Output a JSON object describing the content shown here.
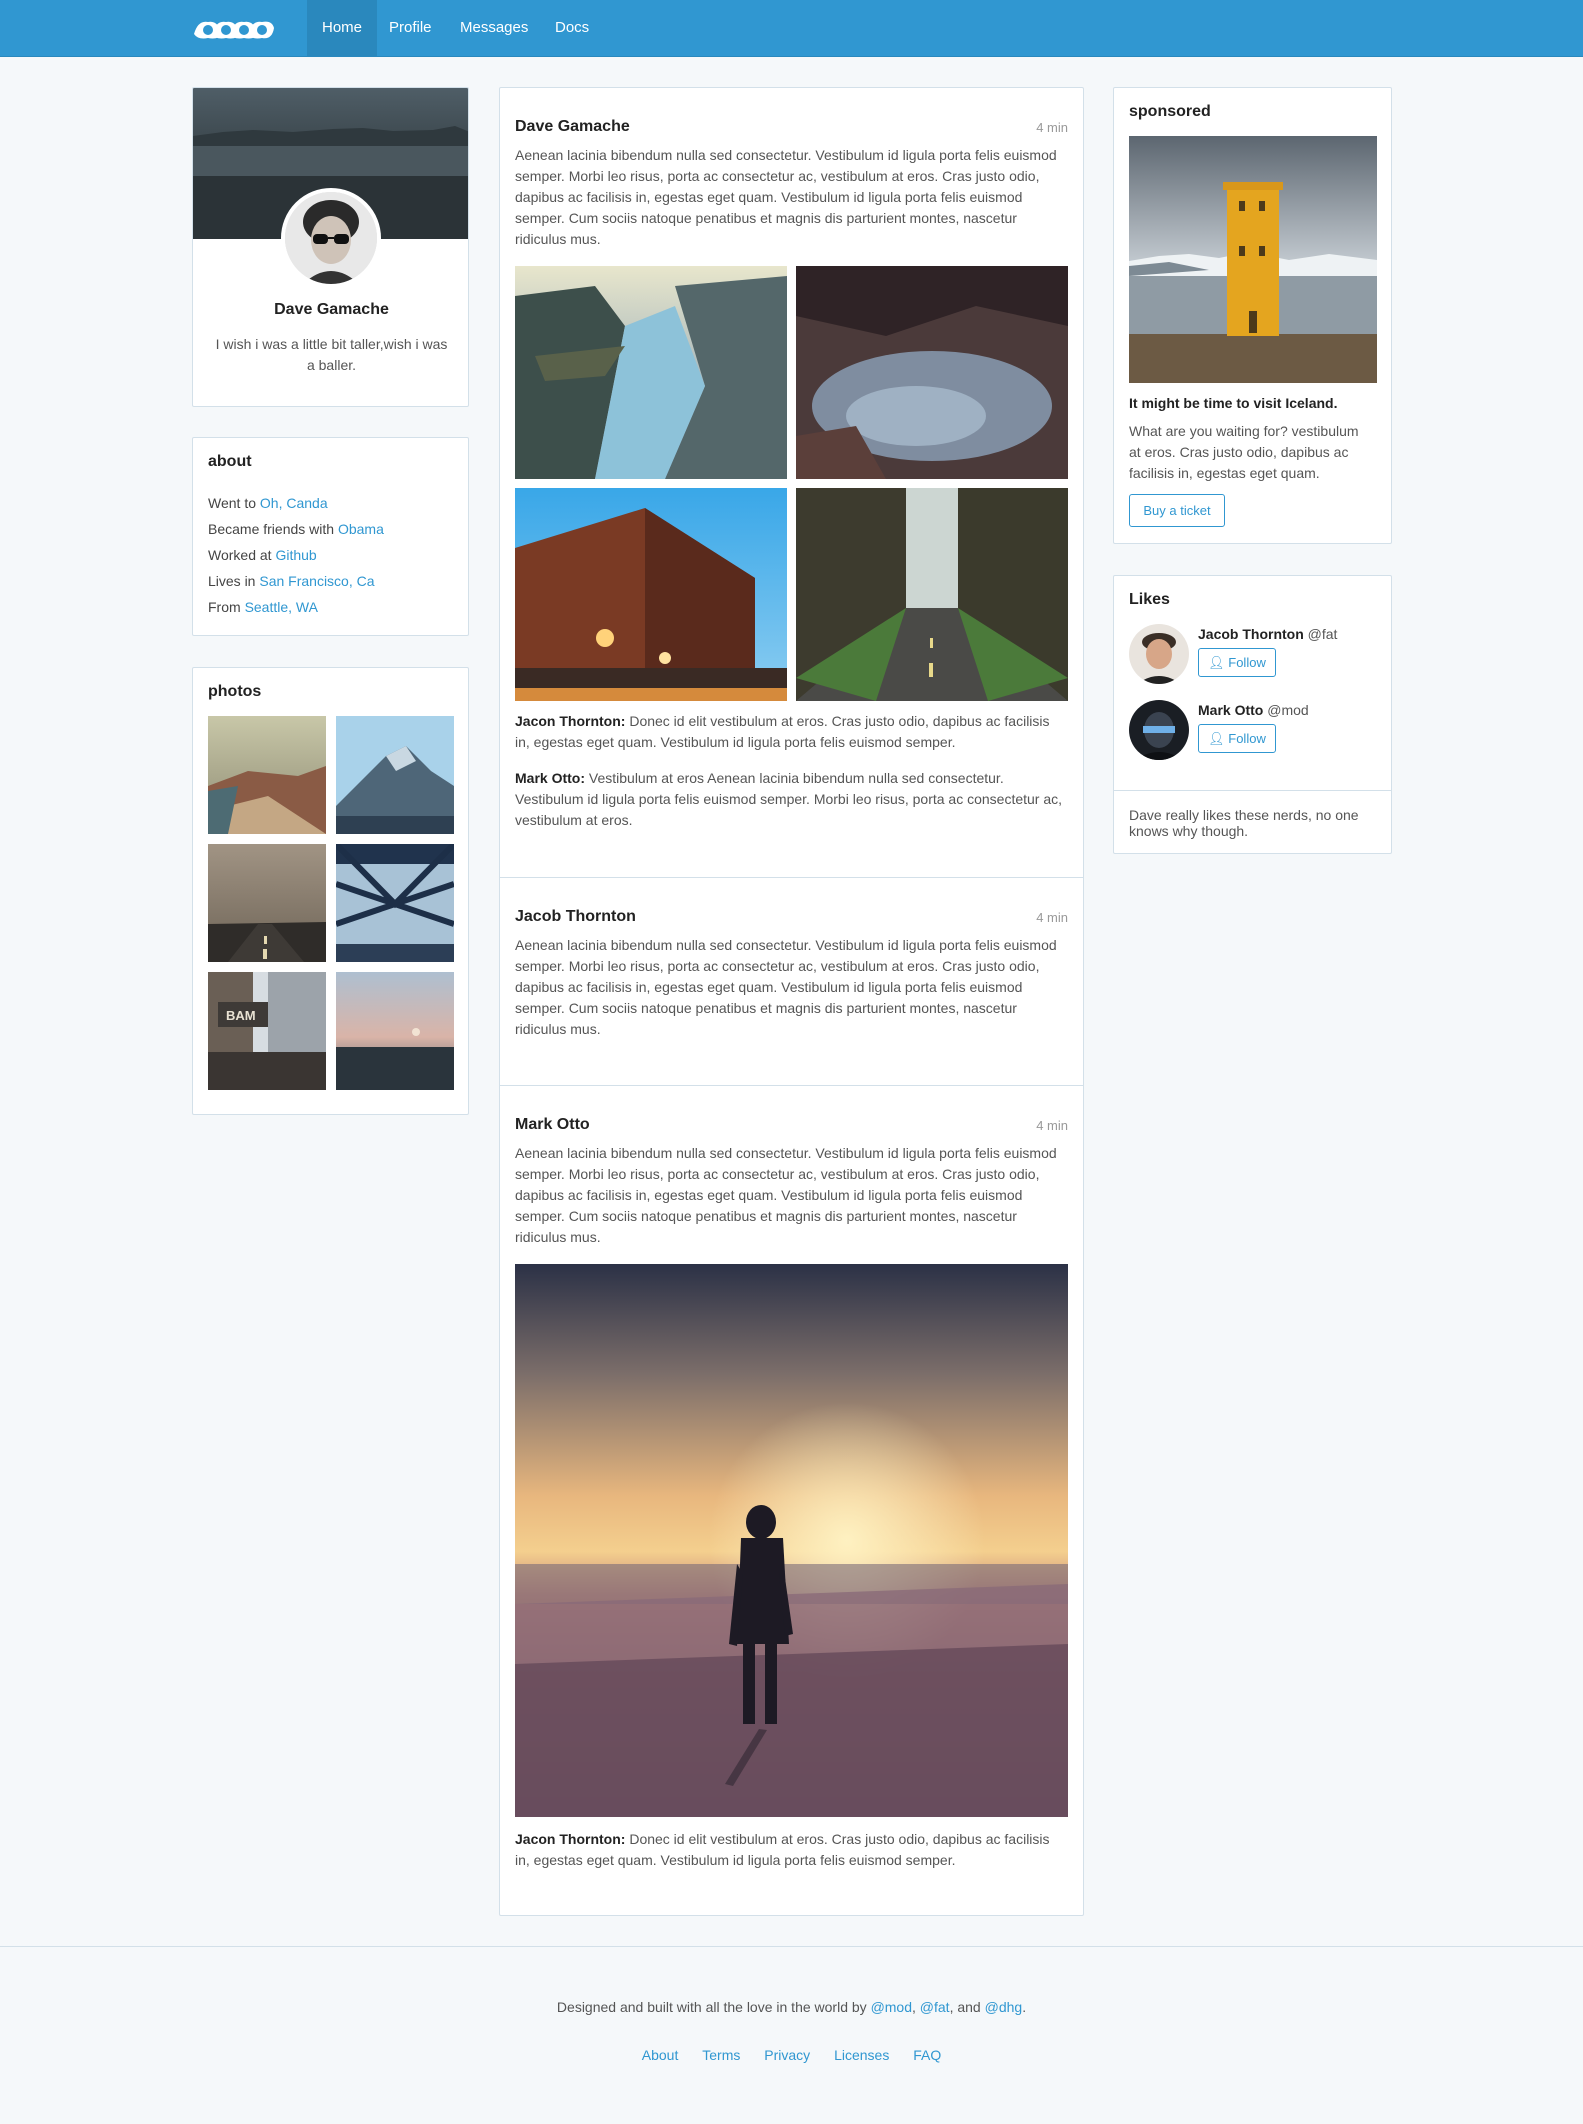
{
  "nav": {
    "brand_icon": "bootstrap-logo-icon",
    "items": [
      {
        "label": "Home",
        "active": true
      },
      {
        "label": "Profile"
      },
      {
        "label": "Messages"
      },
      {
        "label": "Docs"
      }
    ]
  },
  "profile": {
    "name": "Dave Gamache",
    "bio": "I wish i was a little bit taller,wish i was a baller."
  },
  "about": {
    "title": "about",
    "items": [
      {
        "prefix": "Went to ",
        "link": "Oh, Canda"
      },
      {
        "prefix": "Became friends with ",
        "link": "Obama"
      },
      {
        "prefix": "Worked at ",
        "link": "Github"
      },
      {
        "prefix": "Lives in ",
        "link": "San Francisco, Ca"
      },
      {
        "prefix": "From ",
        "link": "Seattle, WA"
      }
    ]
  },
  "photos": {
    "title": "photos"
  },
  "feed": {
    "posts": [
      {
        "author": "Dave Gamache",
        "time": "4 min",
        "body": "Aenean lacinia bibendum nulla sed consectetur. Vestibulum id ligula porta felis euismod semper. Morbi leo risus, porta ac consectetur ac, vestibulum at eros. Cras justo odio, dapibus ac facilisis in, egestas eget quam. Vestibulum id ligula porta felis euismod semper. Cum sociis natoque penatibus et magnis dis parturient montes, nascetur ridiculus mus.",
        "comments": [
          {
            "author": "Jacon Thornton:",
            "text": " Donec id elit vestibulum at eros. Cras justo odio, dapibus ac facilisis in, egestas eget quam. Vestibulum id ligula porta felis euismod semper."
          },
          {
            "author": "Mark Otto:",
            "text": " Vestibulum at eros Aenean lacinia bibendum nulla sed consectetur. Vestibulum id ligula porta felis euismod semper. Morbi leo risus, porta ac consectetur ac, vestibulum at eros."
          }
        ]
      },
      {
        "author": "Jacob Thornton",
        "time": "4 min",
        "body": "Aenean lacinia bibendum nulla sed consectetur. Vestibulum id ligula porta felis euismod semper. Morbi leo risus, porta ac consectetur ac, vestibulum at eros. Cras justo odio, dapibus ac facilisis in, egestas eget quam. Vestibulum id ligula porta felis euismod semper. Cum sociis natoque penatibus et magnis dis parturient montes, nascetur ridiculus mus."
      },
      {
        "author": "Mark Otto",
        "time": "4 min",
        "body": "Aenean lacinia bibendum nulla sed consectetur. Vestibulum id ligula porta felis euismod semper. Morbi leo risus, porta ac consectetur ac, vestibulum at eros. Cras justo odio, dapibus ac facilisis in, egestas eget quam. Vestibulum id ligula porta felis euismod semper. Cum sociis natoque penatibus et magnis dis parturient montes, nascetur ridiculus mus.",
        "comments": [
          {
            "author": "Jacon Thornton:",
            "text": " Donec id elit vestibulum at eros. Cras justo odio, dapibus ac facilisis in, egestas eget quam. Vestibulum id ligula porta felis euismod semper."
          }
        ]
      }
    ]
  },
  "sponsored": {
    "title": "sponsored",
    "headline": "It might be time to visit Iceland.",
    "text": "What are you waiting for? vestibulum at eros. Cras justo odio, dapibus ac facilisis in, egestas eget quam.",
    "button": "Buy a ticket"
  },
  "likes": {
    "title": "Likes",
    "people": [
      {
        "name": "Jacob Thornton",
        "handle": " @fat",
        "button": "Follow"
      },
      {
        "name": "Mark Otto",
        "handle": " @mod",
        "button": "Follow"
      }
    ],
    "footer": "Dave really likes these nerds, no one knows why though."
  },
  "footer": {
    "text_prefix": "Designed and built with all the love in the world by ",
    "handles": [
      "@mod",
      "@fat",
      "@dhg"
    ],
    "sep1": ", ",
    "sep2": ", and ",
    "end": ".",
    "links": [
      "About",
      "Terms",
      "Privacy",
      "Licenses",
      "FAQ"
    ]
  },
  "colors": {
    "primary": "#3097d1",
    "primary_dark": "#2a88bd",
    "background": "#f5f8fa",
    "border": "#d3e0e9"
  }
}
